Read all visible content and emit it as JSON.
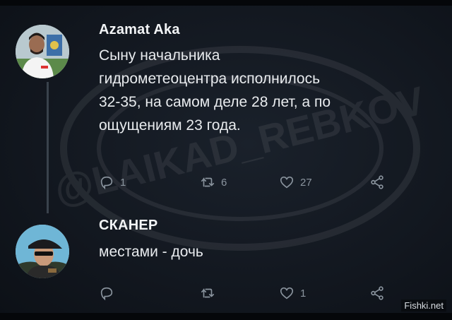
{
  "tweets": [
    {
      "author": "Azamat Aka",
      "lines": [
        "Сыну начальника",
        "гидрометеоцентра исполнилось",
        "32-35, на самом деле 28 лет, а по",
        "ощущениям 23 года."
      ],
      "replies": "1",
      "retweets": "6",
      "likes": "27"
    },
    {
      "author": "СКАНЕР",
      "lines": [
        "местами - дочь"
      ],
      "replies": "",
      "retweets": "",
      "likes": "1"
    }
  ],
  "watermark_text": "@LAIKAD_REBKOV",
  "credit": "Fishki.net",
  "icons": [
    "reply-icon",
    "retweet-icon",
    "like-icon",
    "share-icon"
  ],
  "colors": {
    "background": "#0f141b",
    "text": "#e8ebee",
    "muted": "#8a949e"
  }
}
